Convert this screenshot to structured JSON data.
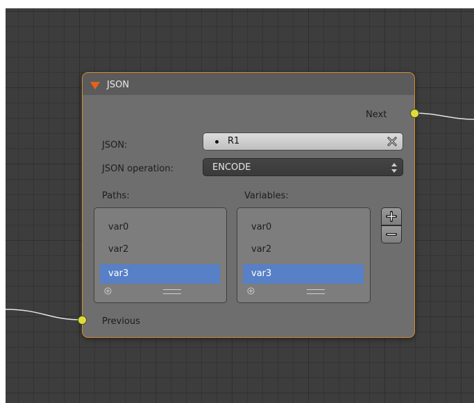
{
  "node": {
    "title": "JSON",
    "output_socket_label": "Next",
    "input_socket_label": "Previous",
    "json_field": {
      "label": "JSON:",
      "value": "R1"
    },
    "operation_field": {
      "label": "JSON operation:",
      "value": "ENCODE"
    },
    "paths": {
      "header": "Paths:",
      "items": [
        "var0",
        "var2",
        "var3"
      ],
      "selected_index": 2
    },
    "variables": {
      "header": "Variables:",
      "items": [
        "var0",
        "var2",
        "var3"
      ],
      "selected_index": 2
    }
  },
  "colors": {
    "node_border": "#d98b2e",
    "socket": "#dedc3b",
    "selection": "#5780c6",
    "collapse_arrow": "#e8611a"
  },
  "icons": [
    "collapse-arrow-icon",
    "clear-x-icon",
    "up-down-arrows-icon",
    "plus-icon",
    "minus-icon",
    "add-circle-icon",
    "grip-icon"
  ]
}
